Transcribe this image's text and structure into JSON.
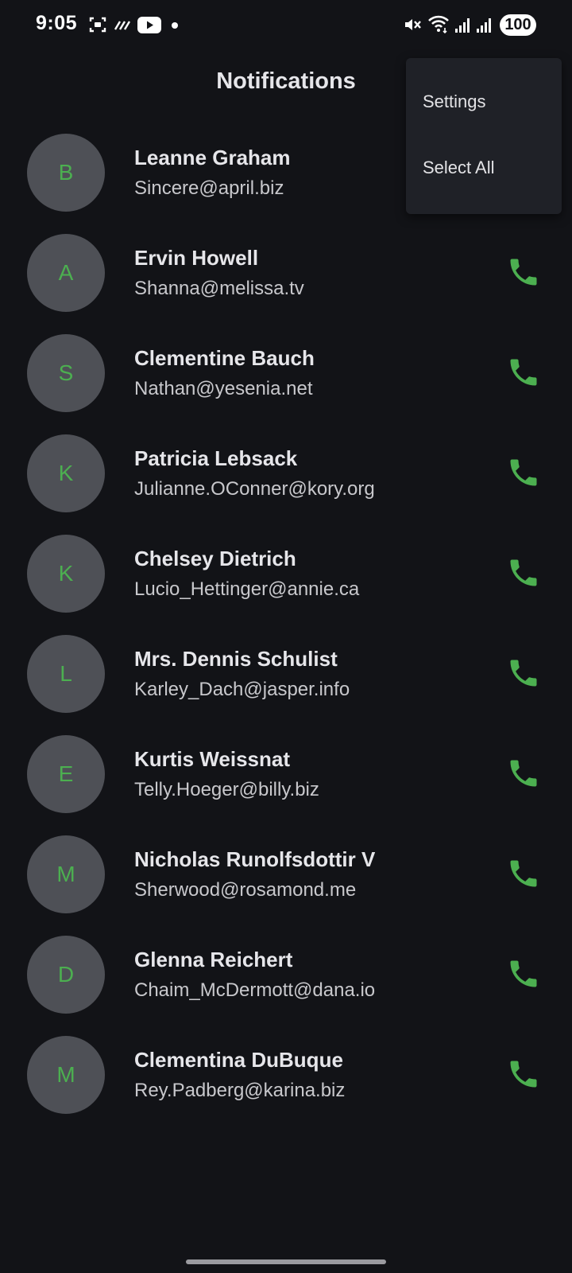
{
  "status_bar": {
    "time": "9:05",
    "battery": "100",
    "icons": [
      "screenshot-icon",
      "data-saver-icon",
      "youtube-icon",
      "notification-dot-icon",
      "mute-icon",
      "wifi-icon",
      "signal-icon",
      "signal-icon"
    ]
  },
  "header": {
    "title": "Notifications"
  },
  "menu": {
    "items": [
      "Settings",
      "Select All"
    ]
  },
  "colors": {
    "background": "#121317",
    "accent": "#4caf50",
    "avatar_bg": "#4e5056",
    "menu_bg": "#1f2127"
  },
  "contacts": [
    {
      "initial": "B",
      "name": "Leanne Graham",
      "email": "Sincere@april.biz"
    },
    {
      "initial": "A",
      "name": "Ervin Howell",
      "email": "Shanna@melissa.tv"
    },
    {
      "initial": "S",
      "name": "Clementine Bauch",
      "email": "Nathan@yesenia.net"
    },
    {
      "initial": "K",
      "name": "Patricia Lebsack",
      "email": "Julianne.OConner@kory.org"
    },
    {
      "initial": "K",
      "name": "Chelsey Dietrich",
      "email": "Lucio_Hettinger@annie.ca"
    },
    {
      "initial": "L",
      "name": "Mrs. Dennis Schulist",
      "email": "Karley_Dach@jasper.info"
    },
    {
      "initial": "E",
      "name": "Kurtis Weissnat",
      "email": "Telly.Hoeger@billy.biz"
    },
    {
      "initial": "M",
      "name": "Nicholas Runolfsdottir V",
      "email": "Sherwood@rosamond.me"
    },
    {
      "initial": "D",
      "name": "Glenna Reichert",
      "email": "Chaim_McDermott@dana.io"
    },
    {
      "initial": "M",
      "name": "Clementina DuBuque",
      "email": "Rey.Padberg@karina.biz"
    }
  ]
}
